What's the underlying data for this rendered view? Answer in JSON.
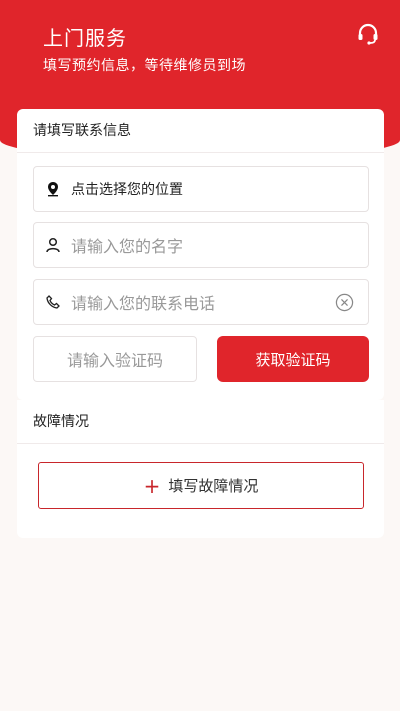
{
  "header": {
    "title": "上门服务",
    "subtitle": "填写预约信息，等待维修员到场",
    "support_icon": "headset-icon"
  },
  "contact": {
    "title": "请填写联系信息",
    "location_label": "点击选择您的位置",
    "name_placeholder": "请输入您的名字",
    "phone_placeholder": "请输入您的联系电话",
    "code_placeholder": "请输入验证码",
    "get_code_label": "获取验证码"
  },
  "fault": {
    "title": "故障情况",
    "add_label": "填写故障情况",
    "add_icon": "+"
  },
  "colors": {
    "accent": "#e0252b",
    "background": "#fcf8f6"
  }
}
